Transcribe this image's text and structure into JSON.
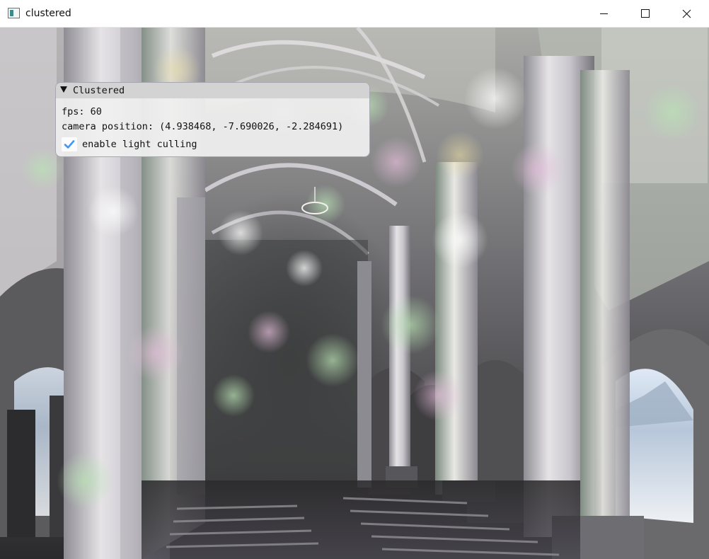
{
  "window": {
    "title": "clustered",
    "icon": "app-window-icon",
    "controls": {
      "minimize_icon": "minimize-icon",
      "maximize_icon": "maximize-icon",
      "close_icon": "close-icon"
    }
  },
  "viewport": {
    "scene": "rendered-church-interior-with-many-colored-point-lights"
  },
  "panel": {
    "title": "Clustered",
    "collapse_icon": "collapse-arrow-icon",
    "fps_line": "fps: 60",
    "camera_line": "camera position: (4.938468, -7.690026, -2.284691)",
    "checkbox": {
      "label": "enable light culling",
      "checked": true,
      "check_icon": "checkmark-icon"
    }
  },
  "colors": {
    "panel_bg": "#f0f0f0",
    "panel_title_bg": "#d1d1d1",
    "checkmark": "#4296fa",
    "titlebar_bg": "#ffffff"
  }
}
